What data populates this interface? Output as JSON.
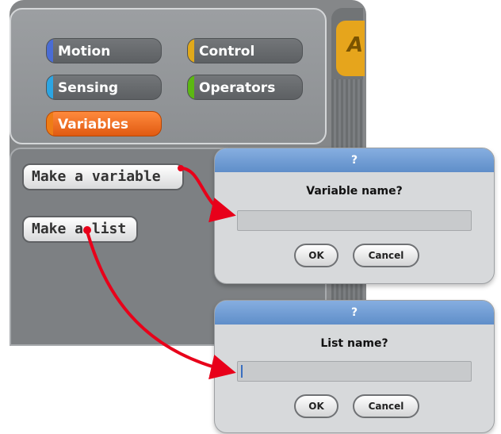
{
  "categories": {
    "motion": {
      "label": "Motion",
      "color": "#4a6cd4"
    },
    "control": {
      "label": "Control",
      "color": "#e1a91a"
    },
    "sensing": {
      "label": "Sensing",
      "color": "#2ca5e2"
    },
    "operators": {
      "label": "Operators",
      "color": "#5cb712"
    },
    "variables": {
      "label": "Variables",
      "color": "#ee7d16",
      "selected": true
    }
  },
  "blocks": {
    "make_variable": "Make a variable",
    "make_list": "Make a list"
  },
  "right_panel": {
    "tab_glyph": "A"
  },
  "dialog_variable": {
    "title": "?",
    "prompt": "Variable name?",
    "input_value": "",
    "ok_label": "OK",
    "cancel_label": "Cancel"
  },
  "dialog_list": {
    "title": "?",
    "prompt": "List name?",
    "input_value": "",
    "ok_label": "OK",
    "cancel_label": "Cancel"
  },
  "arrow_color": "#e8001a"
}
